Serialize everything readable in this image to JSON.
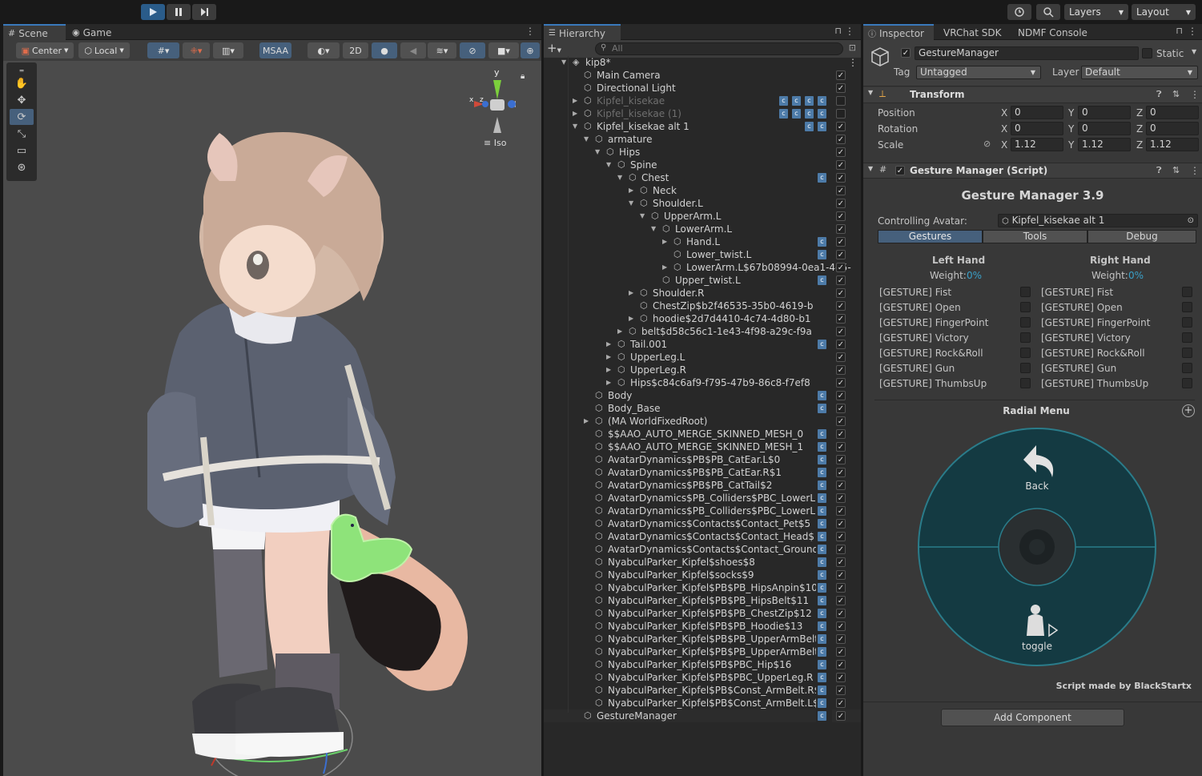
{
  "toolbar": {
    "layers_label": "Layers",
    "layout_label": "Layout"
  },
  "scene": {
    "tabs": [
      {
        "label": "Scene"
      },
      {
        "label": "Game"
      }
    ],
    "pivot_label": "Center",
    "space_label": "Local",
    "msaa_label": "MSAA",
    "mode_2d_label": "2D",
    "gizmo_axis_y": "y",
    "gizmo_axis_x": "x",
    "gizmo_axis_z": "z",
    "iso_label": "Iso"
  },
  "hierarchy": {
    "tab_label": "Hierarchy",
    "search_placeholder": "All",
    "rows": [
      {
        "label": "kip8*",
        "depth": 0,
        "arrow": "down",
        "icon": "unity-scene-icon",
        "dim": false,
        "checked": null,
        "comps": 0
      },
      {
        "label": "Main Camera",
        "depth": 1,
        "arrow": "",
        "icon": "gameobject-icon",
        "dim": false,
        "checked": true,
        "comps": 0
      },
      {
        "label": "Directional Light",
        "depth": 1,
        "arrow": "",
        "icon": "gameobject-icon",
        "dim": false,
        "checked": true,
        "comps": 0
      },
      {
        "label": "Kipfel_kisekae",
        "depth": 1,
        "arrow": "right",
        "icon": "gameobject-icon",
        "dim": true,
        "checked": false,
        "comps": 4
      },
      {
        "label": "Kipfel_kisekae (1)",
        "depth": 1,
        "arrow": "right",
        "icon": "gameobject-icon",
        "dim": true,
        "checked": false,
        "comps": 4
      },
      {
        "label": "Kipfel_kisekae alt 1",
        "depth": 1,
        "arrow": "down",
        "icon": "gameobject-icon",
        "dim": false,
        "checked": true,
        "comps": 2
      },
      {
        "label": "armature",
        "depth": 2,
        "arrow": "down",
        "icon": "gameobject-icon",
        "dim": false,
        "checked": true,
        "comps": 0
      },
      {
        "label": "Hips",
        "depth": 3,
        "arrow": "down",
        "icon": "gameobject-icon",
        "dim": false,
        "checked": true,
        "comps": 0
      },
      {
        "label": "Spine",
        "depth": 4,
        "arrow": "down",
        "icon": "gameobject-icon",
        "dim": false,
        "checked": true,
        "comps": 0
      },
      {
        "label": "Chest",
        "depth": 5,
        "arrow": "down",
        "icon": "gameobject-icon",
        "dim": false,
        "checked": true,
        "comps": 1
      },
      {
        "label": "Neck",
        "depth": 6,
        "arrow": "right",
        "icon": "gameobject-icon",
        "dim": false,
        "checked": true,
        "comps": 0
      },
      {
        "label": "Shoulder.L",
        "depth": 6,
        "arrow": "down",
        "icon": "gameobject-icon",
        "dim": false,
        "checked": true,
        "comps": 0
      },
      {
        "label": "UpperArm.L",
        "depth": 7,
        "arrow": "down",
        "icon": "gameobject-icon",
        "dim": false,
        "checked": true,
        "comps": 0
      },
      {
        "label": "LowerArm.L",
        "depth": 8,
        "arrow": "down",
        "icon": "gameobject-icon",
        "dim": false,
        "checked": true,
        "comps": 0
      },
      {
        "label": "Hand.L",
        "depth": 9,
        "arrow": "right",
        "icon": "gameobject-icon",
        "dim": false,
        "checked": true,
        "comps": 1
      },
      {
        "label": "Lower_twist.L",
        "depth": 9,
        "arrow": "",
        "icon": "gameobject-icon",
        "dim": false,
        "checked": true,
        "comps": 1
      },
      {
        "label": "LowerArm.L$67b08994-0ea1-4d5-",
        "depth": 9,
        "arrow": "right",
        "icon": "gameobject-icon",
        "dim": false,
        "checked": true,
        "comps": 0
      },
      {
        "label": "Upper_twist.L",
        "depth": 8,
        "arrow": "",
        "icon": "gameobject-icon",
        "dim": false,
        "checked": true,
        "comps": 1
      },
      {
        "label": "Shoulder.R",
        "depth": 6,
        "arrow": "right",
        "icon": "gameobject-icon",
        "dim": false,
        "checked": true,
        "comps": 0
      },
      {
        "label": "ChestZip$b2f46535-35b0-4619-b",
        "depth": 6,
        "arrow": "",
        "icon": "gameobject-icon",
        "dim": false,
        "checked": true,
        "comps": 0
      },
      {
        "label": "hoodie$2d7d4410-4c74-4d80-b1",
        "depth": 6,
        "arrow": "right",
        "icon": "gameobject-icon",
        "dim": false,
        "checked": true,
        "comps": 0
      },
      {
        "label": "belt$d58c56c1-1e43-4f98-a29c-f9a",
        "depth": 5,
        "arrow": "right",
        "icon": "gameobject-icon",
        "dim": false,
        "checked": true,
        "comps": 0
      },
      {
        "label": "Tail.001",
        "depth": 4,
        "arrow": "right",
        "icon": "gameobject-icon",
        "dim": false,
        "checked": true,
        "comps": 1
      },
      {
        "label": "UpperLeg.L",
        "depth": 4,
        "arrow": "right",
        "icon": "gameobject-icon",
        "dim": false,
        "checked": true,
        "comps": 0
      },
      {
        "label": "UpperLeg.R",
        "depth": 4,
        "arrow": "right",
        "icon": "gameobject-icon",
        "dim": false,
        "checked": true,
        "comps": 0
      },
      {
        "label": "Hips$c84c6af9-f795-47b9-86c8-f7ef8",
        "depth": 4,
        "arrow": "right",
        "icon": "gameobject-icon",
        "dim": false,
        "checked": true,
        "comps": 0
      },
      {
        "label": "Body",
        "depth": 2,
        "arrow": "",
        "icon": "gameobject-icon",
        "dim": false,
        "checked": true,
        "comps": 1
      },
      {
        "label": "Body_Base",
        "depth": 2,
        "arrow": "",
        "icon": "gameobject-icon",
        "dim": false,
        "checked": true,
        "comps": 1
      },
      {
        "label": "(MA WorldFixedRoot)",
        "depth": 2,
        "arrow": "right",
        "icon": "gameobject-icon",
        "dim": false,
        "checked": true,
        "comps": 0
      },
      {
        "label": "$$AAO_AUTO_MERGE_SKINNED_MESH_0",
        "depth": 2,
        "arrow": "",
        "icon": "gameobject-icon",
        "dim": false,
        "checked": true,
        "comps": 1
      },
      {
        "label": "$$AAO_AUTO_MERGE_SKINNED_MESH_1",
        "depth": 2,
        "arrow": "",
        "icon": "gameobject-icon",
        "dim": false,
        "checked": true,
        "comps": 1
      },
      {
        "label": "AvatarDynamics$PB$PB_CatEar.L$0",
        "depth": 2,
        "arrow": "",
        "icon": "gameobject-icon",
        "dim": false,
        "checked": true,
        "comps": 1
      },
      {
        "label": "AvatarDynamics$PB$PB_CatEar.R$1",
        "depth": 2,
        "arrow": "",
        "icon": "gameobject-icon",
        "dim": false,
        "checked": true,
        "comps": 1
      },
      {
        "label": "AvatarDynamics$PB$PB_CatTail$2",
        "depth": 2,
        "arrow": "",
        "icon": "gameobject-icon",
        "dim": false,
        "checked": true,
        "comps": 1
      },
      {
        "label": "AvatarDynamics$PB_Colliders$PBC_LowerL",
        "depth": 2,
        "arrow": "",
        "icon": "gameobject-icon",
        "dim": false,
        "checked": true,
        "comps": 1
      },
      {
        "label": "AvatarDynamics$PB_Colliders$PBC_LowerL",
        "depth": 2,
        "arrow": "",
        "icon": "gameobject-icon",
        "dim": false,
        "checked": true,
        "comps": 1
      },
      {
        "label": "AvatarDynamics$Contacts$Contact_Pet$5",
        "depth": 2,
        "arrow": "",
        "icon": "gameobject-icon",
        "dim": false,
        "checked": true,
        "comps": 1
      },
      {
        "label": "AvatarDynamics$Contacts$Contact_Head$",
        "depth": 2,
        "arrow": "",
        "icon": "gameobject-icon",
        "dim": false,
        "checked": true,
        "comps": 1
      },
      {
        "label": "AvatarDynamics$Contacts$Contact_Ground",
        "depth": 2,
        "arrow": "",
        "icon": "gameobject-icon",
        "dim": false,
        "checked": true,
        "comps": 1
      },
      {
        "label": "NyabculParker_Kipfel$shoes$8",
        "depth": 2,
        "arrow": "",
        "icon": "gameobject-icon",
        "dim": false,
        "checked": true,
        "comps": 1
      },
      {
        "label": "NyabculParker_Kipfel$socks$9",
        "depth": 2,
        "arrow": "",
        "icon": "gameobject-icon",
        "dim": false,
        "checked": true,
        "comps": 1
      },
      {
        "label": "NyabculParker_Kipfel$PB$PB_HipsAnpin$10",
        "depth": 2,
        "arrow": "",
        "icon": "gameobject-icon",
        "dim": false,
        "checked": true,
        "comps": 1
      },
      {
        "label": "NyabculParker_Kipfel$PB$PB_HipsBelt$11",
        "depth": 2,
        "arrow": "",
        "icon": "gameobject-icon",
        "dim": false,
        "checked": true,
        "comps": 1
      },
      {
        "label": "NyabculParker_Kipfel$PB$PB_ChestZip$12",
        "depth": 2,
        "arrow": "",
        "icon": "gameobject-icon",
        "dim": false,
        "checked": true,
        "comps": 1
      },
      {
        "label": "NyabculParker_Kipfel$PB$PB_Hoodie$13",
        "depth": 2,
        "arrow": "",
        "icon": "gameobject-icon",
        "dim": false,
        "checked": true,
        "comps": 1
      },
      {
        "label": "NyabculParker_Kipfel$PB$PB_UpperArmBelt",
        "depth": 2,
        "arrow": "",
        "icon": "gameobject-icon",
        "dim": false,
        "checked": true,
        "comps": 1
      },
      {
        "label": "NyabculParker_Kipfel$PB$PB_UpperArmBelt",
        "depth": 2,
        "arrow": "",
        "icon": "gameobject-icon",
        "dim": false,
        "checked": true,
        "comps": 1
      },
      {
        "label": "NyabculParker_Kipfel$PB$PBC_Hip$16",
        "depth": 2,
        "arrow": "",
        "icon": "gameobject-icon",
        "dim": false,
        "checked": true,
        "comps": 1
      },
      {
        "label": "NyabculParker_Kipfel$PB$PBC_UpperLeg.R",
        "depth": 2,
        "arrow": "",
        "icon": "gameobject-icon",
        "dim": false,
        "checked": true,
        "comps": 1
      },
      {
        "label": "NyabculParker_Kipfel$PB$Const_ArmBelt.R$",
        "depth": 2,
        "arrow": "",
        "icon": "gameobject-icon",
        "dim": false,
        "checked": true,
        "comps": 1
      },
      {
        "label": "NyabculParker_Kipfel$PB$Const_ArmBelt.L$",
        "depth": 2,
        "arrow": "",
        "icon": "gameobject-icon",
        "dim": false,
        "checked": true,
        "comps": 1
      },
      {
        "label": "GestureManager",
        "depth": 1,
        "arrow": "",
        "icon": "gameobject-icon",
        "dim": false,
        "checked": true,
        "comps": 1,
        "selected": true
      }
    ]
  },
  "inspector": {
    "tabs": [
      {
        "label": "Inspector"
      },
      {
        "label": "VRChat SDK"
      },
      {
        "label": "NDMF Console"
      }
    ],
    "object_name": "GestureManager",
    "static_label": "Static",
    "tag_label": "Tag",
    "tag_value": "Untagged",
    "layer_label": "Layer",
    "layer_value": "Default",
    "transform": {
      "title": "Transform",
      "rows": [
        {
          "label": "Position",
          "x": "0",
          "y": "0",
          "z": "0"
        },
        {
          "label": "Rotation",
          "x": "0",
          "y": "0",
          "z": "0"
        },
        {
          "label": "Scale",
          "x": "1.12",
          "y": "1.12",
          "z": "1.12"
        }
      ],
      "axis_x": "X",
      "axis_y": "Y",
      "axis_z": "Z"
    },
    "gesture_manager": {
      "component_title": "Gesture Manager (Script)",
      "heading": "Gesture Manager 3.9",
      "controlling_label": "Controlling Avatar:",
      "controlling_value": "Kipfel_kisekae alt 1",
      "tabs": [
        {
          "label": "Gestures"
        },
        {
          "label": "Tools"
        },
        {
          "label": "Debug"
        }
      ],
      "left_hand": "Left Hand",
      "right_hand": "Right Hand",
      "weight_label": "Weight:",
      "weight_left": "0%",
      "weight_right": "0%",
      "gestures": [
        "[GESTURE] Fist",
        "[GESTURE] Open",
        "[GESTURE] FingerPoint",
        "[GESTURE] Victory",
        "[GESTURE] Rock&Roll",
        "[GESTURE] Gun",
        "[GESTURE] ThumbsUp"
      ],
      "radial_title": "Radial Menu",
      "back_label": "Back",
      "toggle_label": "toggle",
      "credit": "Script made by BlackStartx"
    },
    "add_component_label": "Add Component"
  },
  "colors": {
    "accent": "#3a79bb",
    "radial_fill": "#143a42",
    "radial_ring": "#2a7c8a",
    "weight_value": "#3aa0c8"
  }
}
